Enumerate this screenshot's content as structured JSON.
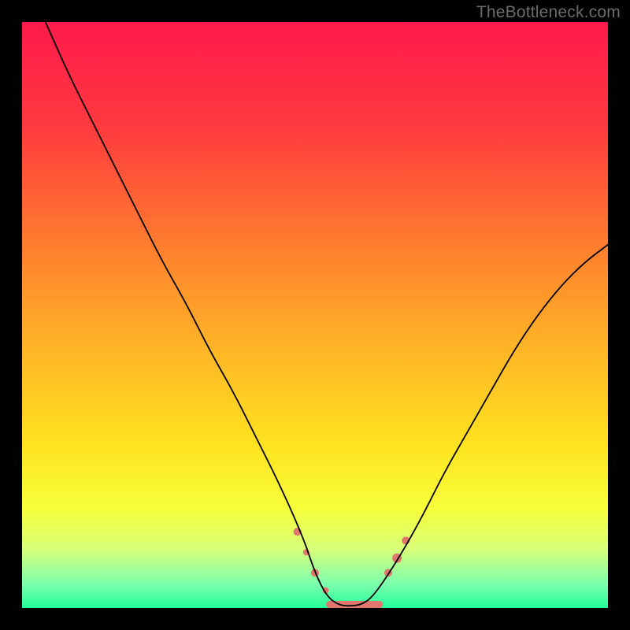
{
  "watermark": "TheBottleneck.com",
  "chart_data": {
    "type": "line",
    "title": "",
    "xlabel": "",
    "ylabel": "",
    "x_range": [
      0,
      100
    ],
    "y_range": [
      0,
      100
    ],
    "legend": false,
    "grid": false,
    "background_gradient": {
      "stops": [
        {
          "offset": 0.0,
          "color": "#ff1a4b"
        },
        {
          "offset": 0.18,
          "color": "#ff3a3f"
        },
        {
          "offset": 0.38,
          "color": "#ff7d2e"
        },
        {
          "offset": 0.55,
          "color": "#ffb327"
        },
        {
          "offset": 0.72,
          "color": "#ffe21f"
        },
        {
          "offset": 0.83,
          "color": "#f7ff3a"
        },
        {
          "offset": 0.9,
          "color": "#d7ff7a"
        },
        {
          "offset": 0.96,
          "color": "#7bffad"
        },
        {
          "offset": 1.0,
          "color": "#23ff9a"
        }
      ]
    },
    "series": [
      {
        "name": "curve",
        "color": "#000000",
        "stroke_width": 1.8,
        "x": [
          4,
          8,
          12,
          16,
          20,
          24,
          28,
          32,
          36,
          40,
          44,
          48,
          50,
          52,
          54,
          56,
          58,
          60,
          64,
          68,
          72,
          76,
          80,
          84,
          88,
          92,
          96,
          100
        ],
        "y": [
          100,
          91,
          83,
          75,
          67,
          59,
          52,
          44,
          37,
          29,
          21,
          12,
          6,
          2,
          0.5,
          0.3,
          0.6,
          2,
          8,
          15,
          23,
          30,
          37,
          44,
          50,
          55,
          59,
          62
        ]
      }
    ],
    "markers": {
      "color": "#e0766e",
      "points": [
        {
          "x": 47.0,
          "y": 13.0,
          "r": 5
        },
        {
          "x": 48.5,
          "y": 9.5,
          "r": 4
        },
        {
          "x": 50.0,
          "y": 6.0,
          "r": 5
        },
        {
          "x": 51.8,
          "y": 3.0,
          "r": 4
        },
        {
          "x": 62.5,
          "y": 6.0,
          "r": 5
        },
        {
          "x": 64.0,
          "y": 8.5,
          "r": 6
        },
        {
          "x": 65.5,
          "y": 11.5,
          "r": 5
        }
      ],
      "flat_bar": {
        "x_start": 52.5,
        "x_end": 61.0,
        "y": 0.6,
        "thickness": 9
      }
    }
  }
}
